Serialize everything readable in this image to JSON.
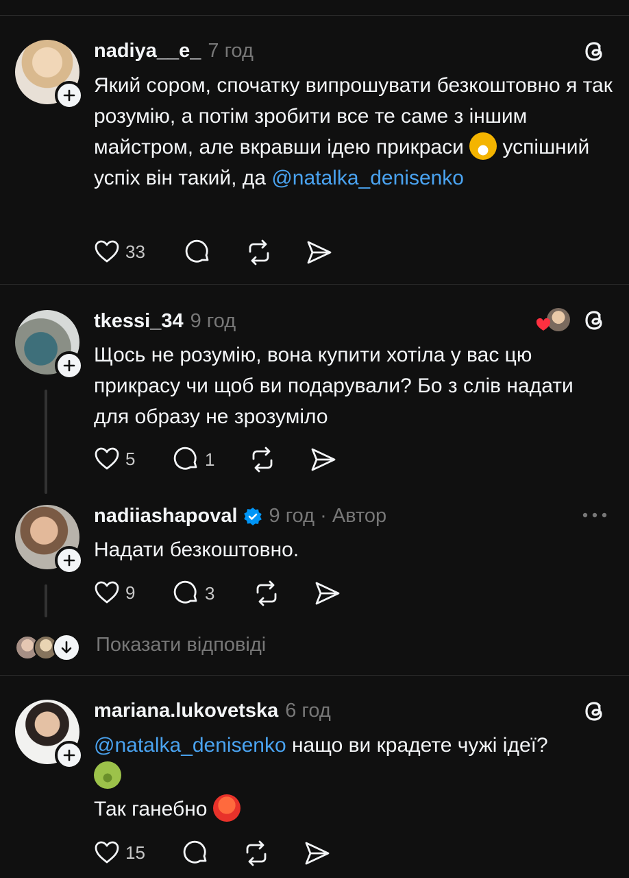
{
  "comments": [
    {
      "username": "nadiya__e_",
      "time": "7 год",
      "text_parts": [
        "Який сором, спочатку випрошувати безкоштовно я так розумію, а потім зробити все те саме з іншим майстром, але вкравши ідею прикраси ",
        " успішний успіх він такий, да "
      ],
      "mention": "@natalka_denisenko",
      "likes": "33",
      "replies": ""
    },
    {
      "username": "tkessi_34",
      "time": "9 год",
      "text": "Щось не розумію, вона купити хотіла у вас цю прикрасу чи щоб ви подарували? Бо з слів надати для образу не зрозуміло",
      "likes": "5",
      "replies": "1"
    },
    {
      "username": "nadiiashapoval",
      "time": "9 год · Автор",
      "text": "Надати безкоштовно.",
      "likes": "9",
      "replies": "3"
    },
    {
      "username": "mariana.lukovetska",
      "time": "6 год",
      "mention": "@natalka_denisenko",
      "text_after_mention": " нащо ви крадете чужі ідеї?",
      "text2": "Так ганебно ",
      "likes": "15",
      "replies": ""
    }
  ],
  "show_replies": "Показати відповіді",
  "icons": [
    "heart-icon",
    "comment-icon",
    "repost-icon",
    "share-icon",
    "threads-icon",
    "verified-icon",
    "more-icon",
    "plus-icon",
    "arrow-down-icon"
  ],
  "colors": {
    "background": "#101010",
    "text": "#f3f5f7",
    "muted": "#777777",
    "mention": "#4aa3f0",
    "verified": "#0095f6"
  }
}
